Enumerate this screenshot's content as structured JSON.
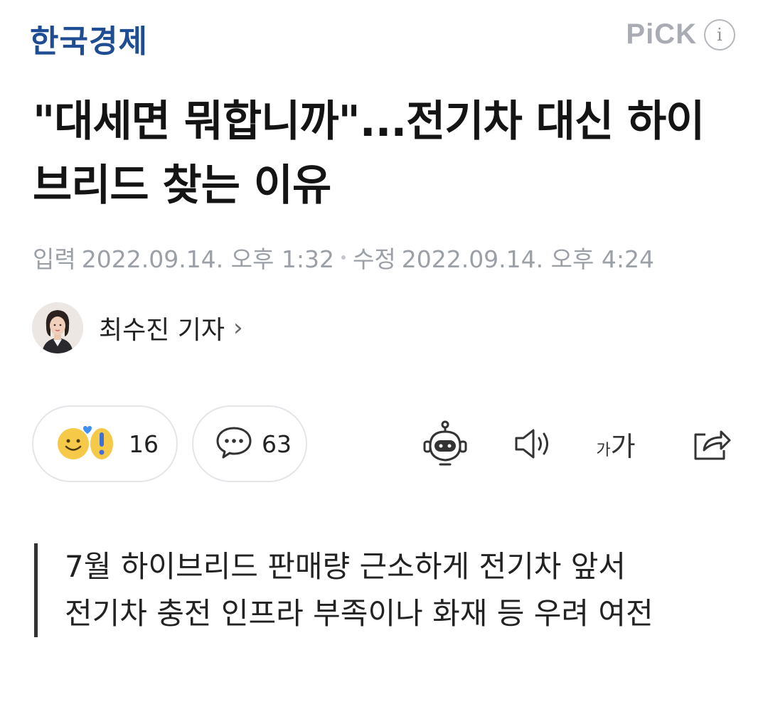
{
  "header": {
    "press_name": "한국경제",
    "pick_label": "PiCK",
    "info_icon": "i"
  },
  "article": {
    "title": "\"대세면 뭐합니까\"...전기차 대신 하이브리드 찾는 이유",
    "published_label": "입력",
    "published": "2022.09.14. 오후 1:32",
    "modified_label": "수정",
    "modified": "2022.09.14. 오후 4:24"
  },
  "reporter": {
    "name": "최수진 기자",
    "chevron": "›"
  },
  "actions": {
    "reaction_count": "16",
    "comment_count": "63",
    "font_small": "가",
    "font_large": "가"
  },
  "summary": {
    "lines": [
      "7월 하이브리드 판매량 근소하게 전기차 앞서",
      "전기차 충전 인프라 부족이나 화재 등 우려 여전"
    ]
  },
  "colors": {
    "brand": "#1f4d93",
    "muted": "#9aa0a6"
  }
}
